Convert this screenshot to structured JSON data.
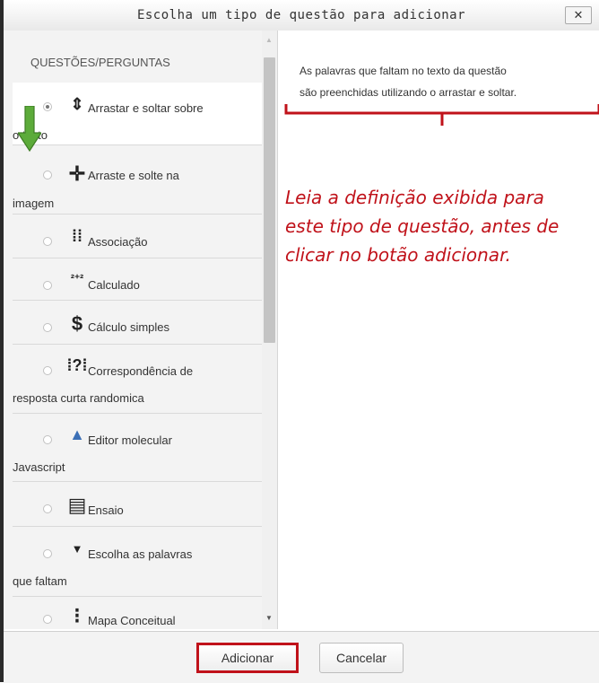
{
  "dialog": {
    "title": "Escolha um tipo de questão para adicionar",
    "close_label": "✕"
  },
  "list": {
    "header": "QUESTÕES/PERGUNTAS",
    "items": [
      {
        "label1": "Arrastar e soltar sobre",
        "label2": "o texto",
        "icon": "drag-drop-text-icon",
        "glyph": "⇕",
        "selected": true
      },
      {
        "label1": "Arraste e solte na",
        "label2": "imagem",
        "icon": "drag-drop-image-icon",
        "glyph": "✛",
        "selected": false
      },
      {
        "label1": "Associação",
        "label2": "",
        "icon": "matching-icon",
        "glyph": "⁞⁞",
        "selected": false
      },
      {
        "label1": "Calculado",
        "label2": "",
        "icon": "calculated-icon",
        "glyph": "²⁺²",
        "selected": false
      },
      {
        "label1": "Cálculo simples",
        "label2": "",
        "icon": "simple-calculated-icon",
        "glyph": "$",
        "selected": false
      },
      {
        "label1": "Correspondência de",
        "label2": "resposta curta randomica",
        "icon": "random-short-answer-matching-icon",
        "glyph": "⁞?⁞",
        "selected": false
      },
      {
        "label1": "Editor molecular",
        "label2": "Javascript",
        "icon": "molecular-editor-icon",
        "glyph": "▲",
        "selected": false
      },
      {
        "label1": "Ensaio",
        "label2": "",
        "icon": "essay-icon",
        "glyph": "▤",
        "selected": false
      },
      {
        "label1": "Escolha as palavras",
        "label2": "que faltam",
        "icon": "select-missing-words-icon",
        "glyph": "▼",
        "selected": false
      },
      {
        "label1": "Mapa Conceitual",
        "label2": "",
        "icon": "concept-map-icon",
        "glyph": "⁝",
        "selected": false
      }
    ]
  },
  "description": {
    "line1": "As palavras que faltam no texto da questão",
    "line2": "são preenchidas utilizando o arrastar e soltar."
  },
  "annotation": {
    "line1": "Leia a definição exibida para",
    "line2": "este tipo de questão, antes de",
    "line3": "clicar no botão adicionar."
  },
  "footer": {
    "add_label": "Adicionar",
    "cancel_label": "Cancelar"
  },
  "colors": {
    "accent_red": "#c0121a",
    "arrow_green": "#5cab3a"
  }
}
